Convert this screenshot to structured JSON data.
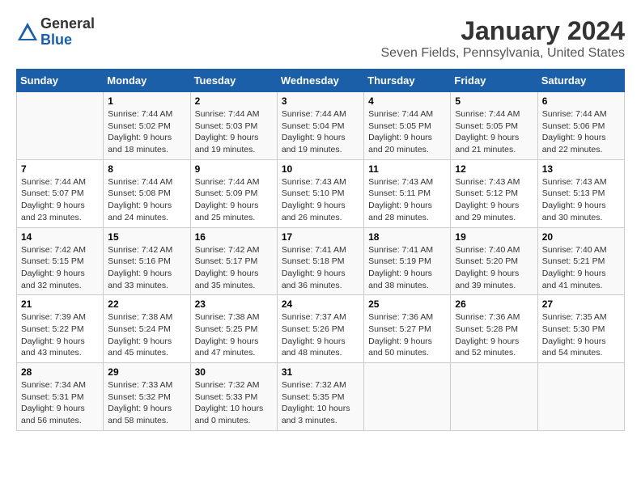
{
  "logo": {
    "general": "General",
    "blue": "Blue"
  },
  "title": "January 2024",
  "location": "Seven Fields, Pennsylvania, United States",
  "days_of_week": [
    "Sunday",
    "Monday",
    "Tuesday",
    "Wednesday",
    "Thursday",
    "Friday",
    "Saturday"
  ],
  "weeks": [
    [
      {
        "day": "",
        "info": ""
      },
      {
        "day": "1",
        "info": "Sunrise: 7:44 AM\nSunset: 5:02 PM\nDaylight: 9 hours\nand 18 minutes."
      },
      {
        "day": "2",
        "info": "Sunrise: 7:44 AM\nSunset: 5:03 PM\nDaylight: 9 hours\nand 19 minutes."
      },
      {
        "day": "3",
        "info": "Sunrise: 7:44 AM\nSunset: 5:04 PM\nDaylight: 9 hours\nand 19 minutes."
      },
      {
        "day": "4",
        "info": "Sunrise: 7:44 AM\nSunset: 5:05 PM\nDaylight: 9 hours\nand 20 minutes."
      },
      {
        "day": "5",
        "info": "Sunrise: 7:44 AM\nSunset: 5:05 PM\nDaylight: 9 hours\nand 21 minutes."
      },
      {
        "day": "6",
        "info": "Sunrise: 7:44 AM\nSunset: 5:06 PM\nDaylight: 9 hours\nand 22 minutes."
      }
    ],
    [
      {
        "day": "7",
        "info": "Sunrise: 7:44 AM\nSunset: 5:07 PM\nDaylight: 9 hours\nand 23 minutes."
      },
      {
        "day": "8",
        "info": "Sunrise: 7:44 AM\nSunset: 5:08 PM\nDaylight: 9 hours\nand 24 minutes."
      },
      {
        "day": "9",
        "info": "Sunrise: 7:44 AM\nSunset: 5:09 PM\nDaylight: 9 hours\nand 25 minutes."
      },
      {
        "day": "10",
        "info": "Sunrise: 7:43 AM\nSunset: 5:10 PM\nDaylight: 9 hours\nand 26 minutes."
      },
      {
        "day": "11",
        "info": "Sunrise: 7:43 AM\nSunset: 5:11 PM\nDaylight: 9 hours\nand 28 minutes."
      },
      {
        "day": "12",
        "info": "Sunrise: 7:43 AM\nSunset: 5:12 PM\nDaylight: 9 hours\nand 29 minutes."
      },
      {
        "day": "13",
        "info": "Sunrise: 7:43 AM\nSunset: 5:13 PM\nDaylight: 9 hours\nand 30 minutes."
      }
    ],
    [
      {
        "day": "14",
        "info": "Sunrise: 7:42 AM\nSunset: 5:15 PM\nDaylight: 9 hours\nand 32 minutes."
      },
      {
        "day": "15",
        "info": "Sunrise: 7:42 AM\nSunset: 5:16 PM\nDaylight: 9 hours\nand 33 minutes."
      },
      {
        "day": "16",
        "info": "Sunrise: 7:42 AM\nSunset: 5:17 PM\nDaylight: 9 hours\nand 35 minutes."
      },
      {
        "day": "17",
        "info": "Sunrise: 7:41 AM\nSunset: 5:18 PM\nDaylight: 9 hours\nand 36 minutes."
      },
      {
        "day": "18",
        "info": "Sunrise: 7:41 AM\nSunset: 5:19 PM\nDaylight: 9 hours\nand 38 minutes."
      },
      {
        "day": "19",
        "info": "Sunrise: 7:40 AM\nSunset: 5:20 PM\nDaylight: 9 hours\nand 39 minutes."
      },
      {
        "day": "20",
        "info": "Sunrise: 7:40 AM\nSunset: 5:21 PM\nDaylight: 9 hours\nand 41 minutes."
      }
    ],
    [
      {
        "day": "21",
        "info": "Sunrise: 7:39 AM\nSunset: 5:22 PM\nDaylight: 9 hours\nand 43 minutes."
      },
      {
        "day": "22",
        "info": "Sunrise: 7:38 AM\nSunset: 5:24 PM\nDaylight: 9 hours\nand 45 minutes."
      },
      {
        "day": "23",
        "info": "Sunrise: 7:38 AM\nSunset: 5:25 PM\nDaylight: 9 hours\nand 47 minutes."
      },
      {
        "day": "24",
        "info": "Sunrise: 7:37 AM\nSunset: 5:26 PM\nDaylight: 9 hours\nand 48 minutes."
      },
      {
        "day": "25",
        "info": "Sunrise: 7:36 AM\nSunset: 5:27 PM\nDaylight: 9 hours\nand 50 minutes."
      },
      {
        "day": "26",
        "info": "Sunrise: 7:36 AM\nSunset: 5:28 PM\nDaylight: 9 hours\nand 52 minutes."
      },
      {
        "day": "27",
        "info": "Sunrise: 7:35 AM\nSunset: 5:30 PM\nDaylight: 9 hours\nand 54 minutes."
      }
    ],
    [
      {
        "day": "28",
        "info": "Sunrise: 7:34 AM\nSunset: 5:31 PM\nDaylight: 9 hours\nand 56 minutes."
      },
      {
        "day": "29",
        "info": "Sunrise: 7:33 AM\nSunset: 5:32 PM\nDaylight: 9 hours\nand 58 minutes."
      },
      {
        "day": "30",
        "info": "Sunrise: 7:32 AM\nSunset: 5:33 PM\nDaylight: 10 hours\nand 0 minutes."
      },
      {
        "day": "31",
        "info": "Sunrise: 7:32 AM\nSunset: 5:35 PM\nDaylight: 10 hours\nand 3 minutes."
      },
      {
        "day": "",
        "info": ""
      },
      {
        "day": "",
        "info": ""
      },
      {
        "day": "",
        "info": ""
      }
    ]
  ]
}
